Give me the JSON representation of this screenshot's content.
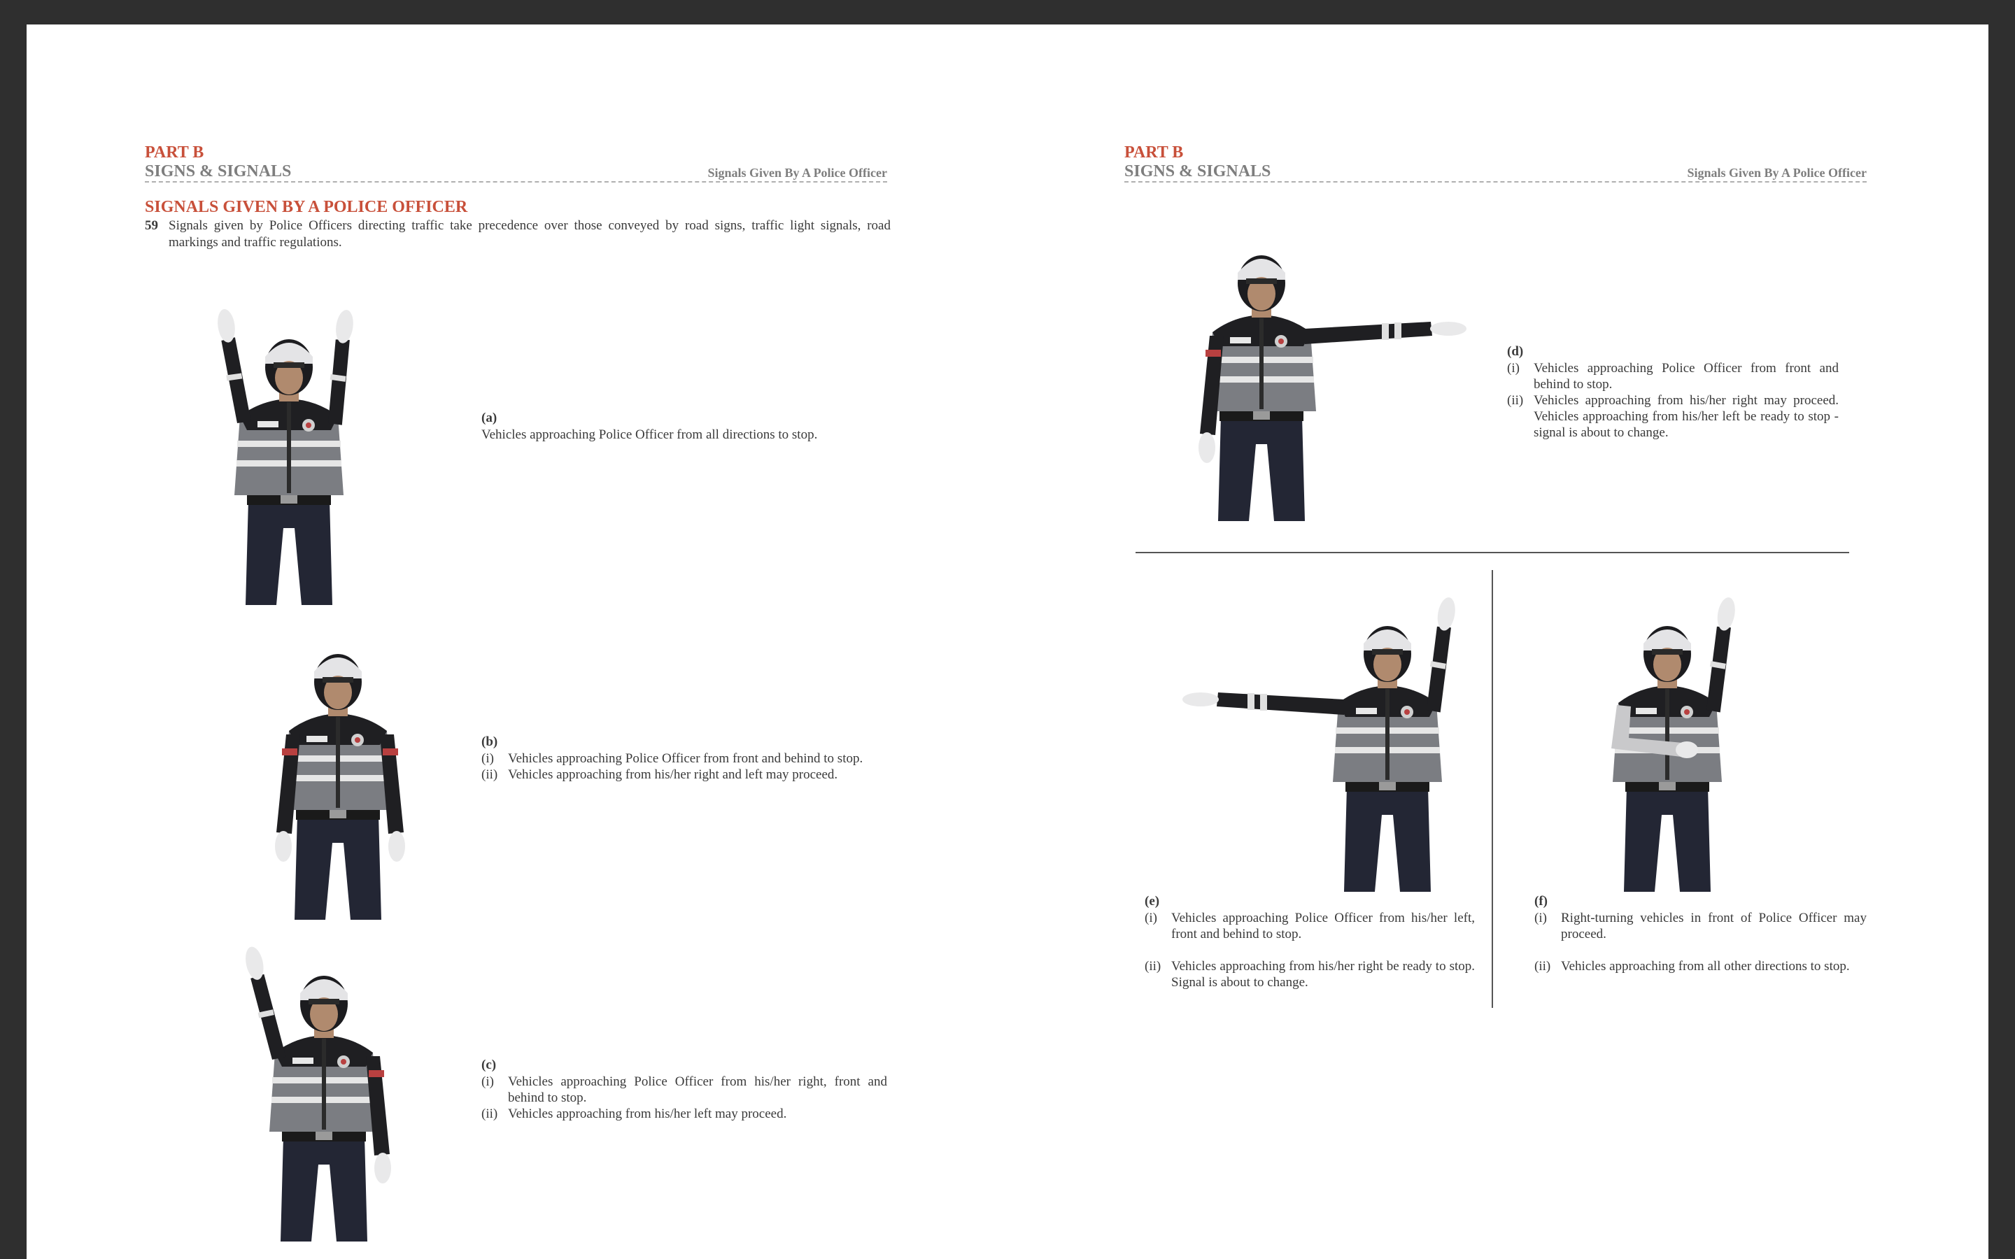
{
  "header": {
    "part": "PART B",
    "section": "SIGNS & SIGNALS",
    "running_title": "Signals Given By A Police Officer"
  },
  "left": {
    "heading": "SIGNALS GIVEN BY A POLICE OFFICER",
    "para_number": "59",
    "para_text": "Signals given by Police Officers directing traffic take precedence over those conveyed by road signs, traffic light signals, road markings and traffic regulations.",
    "signals": [
      {
        "letter": "(a)",
        "text": "Vehicles approaching Police Officer from all directions to stop."
      },
      {
        "letter": "(b)",
        "items": [
          {
            "num": "(i)",
            "text": "Vehicles approaching Police Officer from front and behind to stop."
          },
          {
            "num": "(ii)",
            "text": "Vehicles approaching from his/her right and left may proceed."
          }
        ]
      },
      {
        "letter": "(c)",
        "items": [
          {
            "num": "(i)",
            "text": "Vehicles approaching Police Officer from his/her right, front and behind to stop."
          },
          {
            "num": "(ii)",
            "text": "Vehicles approaching from his/her left may proceed."
          }
        ]
      }
    ]
  },
  "right": {
    "signals": [
      {
        "letter": "(d)",
        "items": [
          {
            "num": "(i)",
            "text": "Vehicles approaching Police Officer from front and behind to stop."
          },
          {
            "num": "(ii)",
            "text": "Vehicles approaching from his/her right may proceed. Vehicles approaching from his/her left be ready to stop - signal is about to change."
          }
        ]
      },
      {
        "letter": "(e)",
        "items": [
          {
            "num": "(i)",
            "text": "Vehicles approaching Police Officer from his/her left, front and behind to stop."
          },
          {
            "num": "(ii)",
            "text": "Vehicles approaching from his/her right be ready to stop. Signal is about to change."
          }
        ]
      },
      {
        "letter": "(f)",
        "items": [
          {
            "num": "(i)",
            "text": "Right-turning vehicles in front of Police Officer may proceed."
          },
          {
            "num": "(ii)",
            "text": "Vehicles approaching from all other directions to stop."
          }
        ]
      }
    ]
  },
  "colors": {
    "accent": "#c8503a",
    "grey_heading": "#7e7e7e",
    "body_text": "#3a3a3a",
    "frame": "#2f2f2f"
  }
}
